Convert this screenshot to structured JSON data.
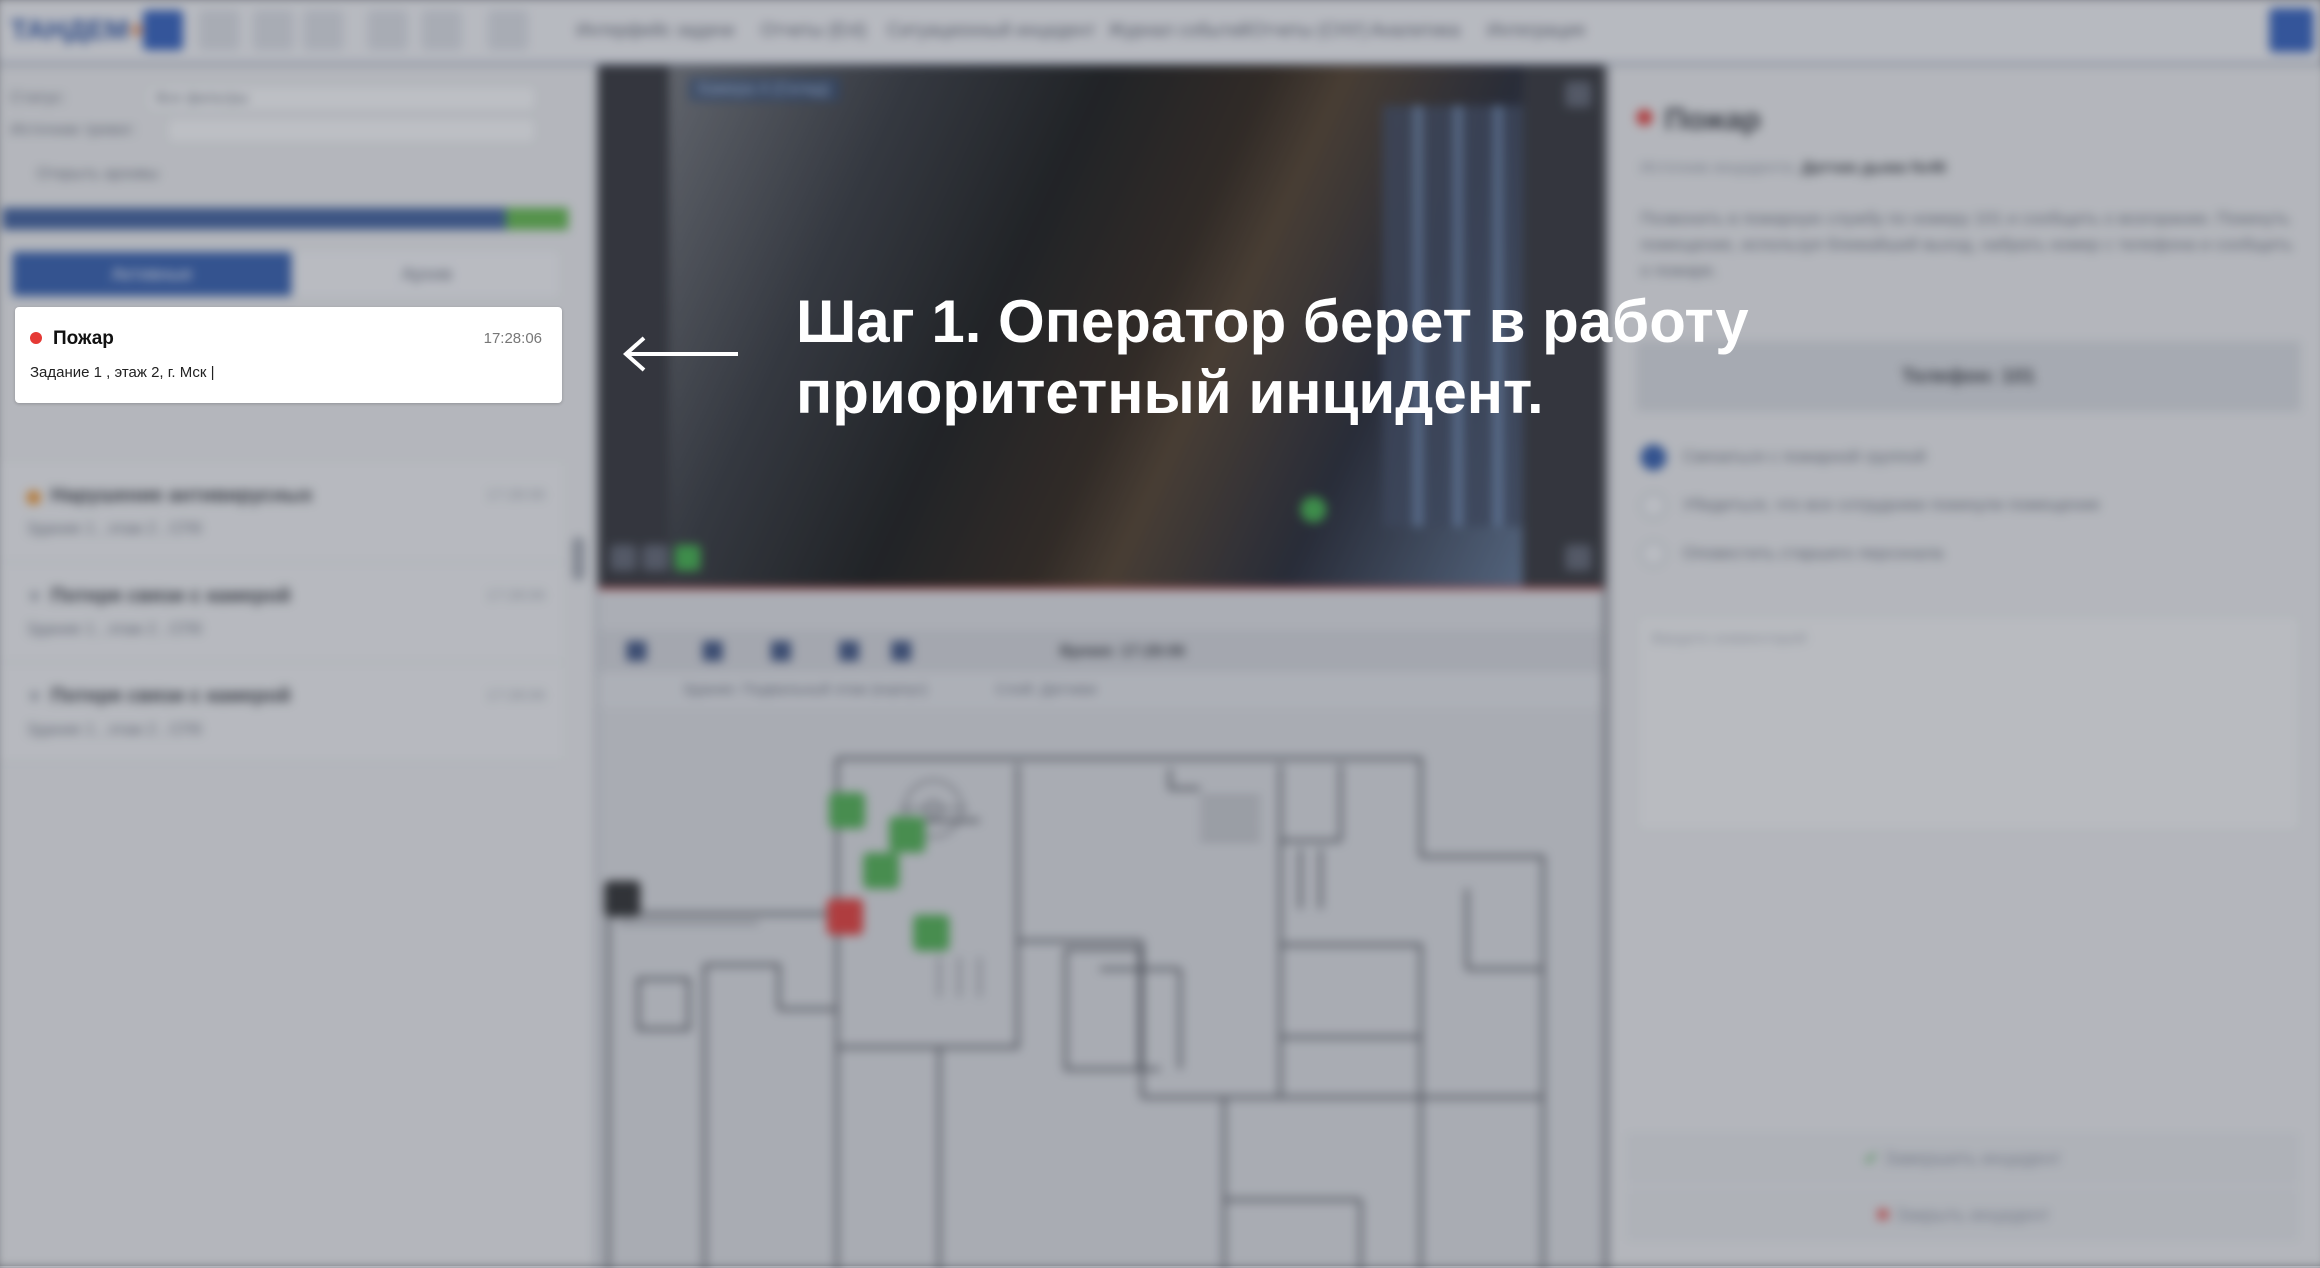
{
  "topbar": {
    "logo_text": "ТАНДЕМ",
    "logo_accent": "+",
    "menu": [
      "Интерфейс задачи",
      "Отчеты (Enl)",
      "Ситуационный инцидент",
      "Журнал событий",
      "Отчеты (СНУ)",
      "Аналитика",
      "Интеграция"
    ]
  },
  "left": {
    "filter_status": "Статус:",
    "filter_status_value": "Все фильтры",
    "filter_source": "Источник тревог:",
    "filter_checkbox": "Открыть архивы",
    "progress": 0.89,
    "tabs": {
      "active": "Активные",
      "inactive": "Архив"
    },
    "incidents": [
      {
        "title": "Нарушение антивирусных",
        "subtitle": "Здание 1 , этаж 2 , СПб",
        "time": "17:28:06"
      },
      {
        "title": "Потеря связи с камерой",
        "subtitle": "Здание 1 , этаж 2 , СПб",
        "time": "17:28:06"
      },
      {
        "title": "Потеря связи с камерой",
        "subtitle": "Здание 1 , этаж 2 , СПб",
        "time": "17:28:06"
      }
    ]
  },
  "priority_incident": {
    "title": "Пожар",
    "time": "17:28:06",
    "description": "Задание 1 , этаж 2, г. Мск |"
  },
  "center": {
    "video_label": "Камера 4 (Склад)",
    "controls_time": "Время: 17:28:06",
    "map_toolbar_floor": "Здание: Подвальный этаж (корпус)",
    "map_toolbar_layer": "Слой: Датчики"
  },
  "right": {
    "title": "Пожар",
    "source_label": "Источник инцидента:",
    "source_value": "Датчик дыма №46",
    "description": "Позвонить в пожарную службу по номеру 101 и сообщить о возгорании. Покинуть помещение, используя ближайший выход, набрать номер с телефона и сообщить о пожаре.",
    "phone_button": "Телефон: 101",
    "options": [
      "Связаться с пожарной группой",
      "Убедиться, что все сотрудники покинули помещение",
      "Оповестить старшего персонала"
    ],
    "comment_placeholder": "Введите комментарий",
    "action_complete": "Завершить инцидент",
    "action_cancel": "Закрыть инцидент"
  },
  "overlay": {
    "step_line1": "Шаг 1. Оператор берет в работу",
    "step_line2": "приоритетный инцидент."
  },
  "colors": {
    "accent_blue": "#2e58a8",
    "alarm_red": "#e53935",
    "sensor_green": "#4aa850"
  }
}
